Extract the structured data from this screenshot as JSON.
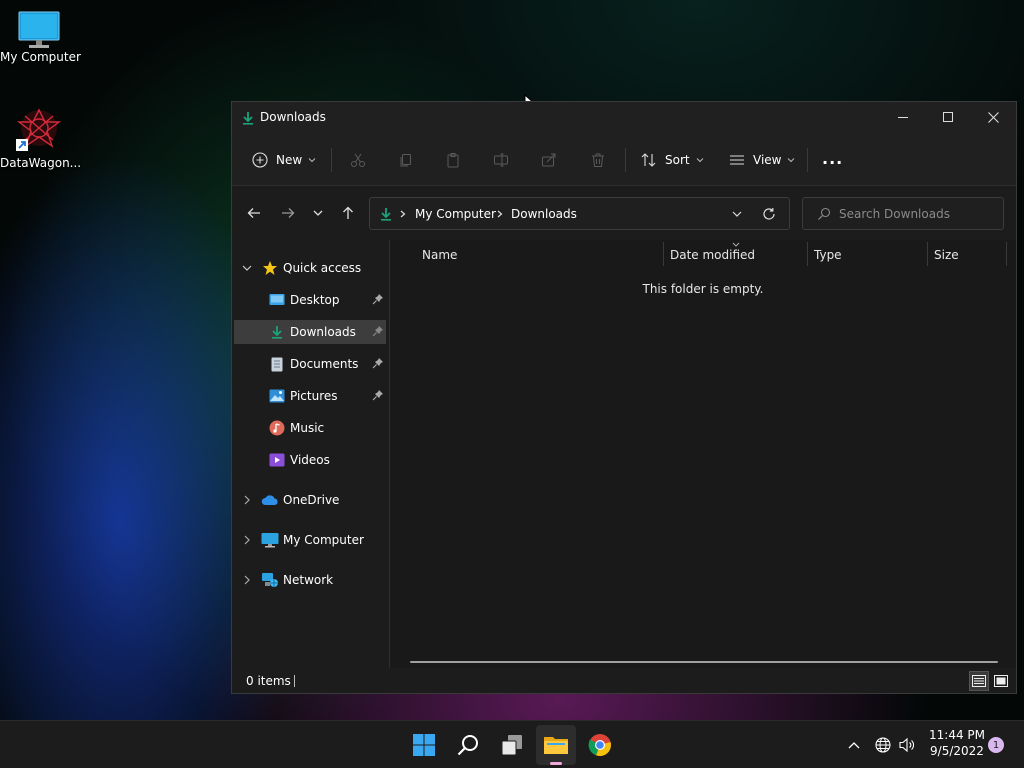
{
  "desktop": {
    "icons": [
      {
        "label": "My Computer"
      },
      {
        "label": "DataWagon..."
      }
    ]
  },
  "window": {
    "title": "Downloads",
    "controls": {
      "minimize": "—",
      "maximize": "☐",
      "close": "✕"
    }
  },
  "toolbar": {
    "new_label": "New",
    "sort_label": "Sort",
    "view_label": "View",
    "more_label": "..."
  },
  "address": {
    "breadcrumbs": [
      "My Computer",
      "Downloads"
    ]
  },
  "search": {
    "placeholder": "Search Downloads"
  },
  "navpane": {
    "quick_access": "Quick access",
    "items": [
      "Desktop",
      "Downloads",
      "Documents",
      "Pictures",
      "Music",
      "Videos"
    ],
    "onedrive": "OneDrive",
    "mycomputer": "My Computer",
    "network": "Network"
  },
  "content": {
    "columns": [
      "Name",
      "Date modified",
      "Type",
      "Size"
    ],
    "empty_message": "This folder is empty."
  },
  "status": {
    "items_count": "0 items"
  },
  "tray": {
    "time": "11:44 PM",
    "date": "9/5/2022",
    "notification_count": "1"
  },
  "colors": {
    "accent": "#1aa37a",
    "window_bg": "#1c1c1c",
    "selection": "#3d3d3d"
  }
}
